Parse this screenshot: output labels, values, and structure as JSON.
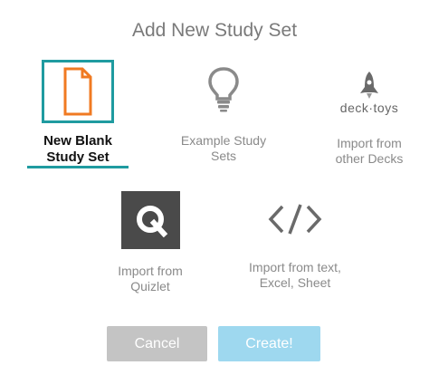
{
  "dialog": {
    "title": "Add New Study Set"
  },
  "options": {
    "blank": {
      "label": "New Blank\nStudy Set",
      "icon": "blank-document-icon",
      "selected": true
    },
    "example": {
      "label": "Example Study\nSets",
      "icon": "lightbulb-icon"
    },
    "decks": {
      "label": "Import from\nother Decks",
      "icon": "rocket-icon",
      "brand": "deck·toys"
    },
    "quizlet": {
      "label": "Import from\nQuizlet",
      "icon": "quizlet-q-icon"
    },
    "text": {
      "label": "Import from text,\nExcel, Sheet",
      "icon": "code-brackets-icon"
    }
  },
  "buttons": {
    "cancel": "Cancel",
    "create": "Create!"
  },
  "colors": {
    "accent": "#1f9ba0",
    "document_icon": "#f07a22",
    "cancel_button": "#c4c4c4",
    "create_button": "#9ed8ef",
    "quizlet_tile": "#4a4a4a"
  }
}
